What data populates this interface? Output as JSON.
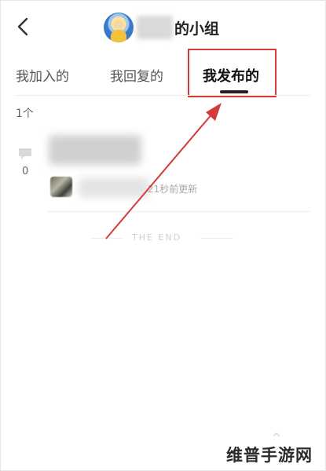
{
  "header": {
    "title": "的小组"
  },
  "tabs": [
    {
      "label": "我加入的",
      "active": false
    },
    {
      "label": "我回复的",
      "active": false
    },
    {
      "label": "我发布的",
      "active": true
    }
  ],
  "list": {
    "count_label": "1个",
    "items": [
      {
        "comment_count": "0",
        "updated": "21秒前更新"
      }
    ],
    "end_text": "THE END"
  },
  "colors": {
    "annotation": "#d43a3a",
    "active_tab_text": "#111111"
  },
  "icons": [
    "back-arrow-icon",
    "comment-icon"
  ],
  "watermark": {
    "glyph": "^",
    "text": "维普手游网"
  }
}
